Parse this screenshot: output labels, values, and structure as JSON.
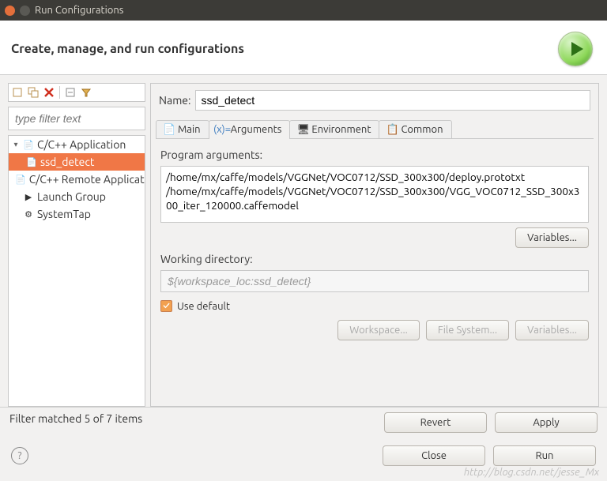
{
  "window": {
    "title": "Run Configurations"
  },
  "header": {
    "heading": "Create, manage, and run configurations"
  },
  "sidebar": {
    "filter_placeholder": "type filter text",
    "items": [
      {
        "label": "C/C++ Application",
        "expanded": true
      },
      {
        "label": "ssd_detect",
        "selected": true,
        "child": true
      },
      {
        "label": "C/C++ Remote Application"
      },
      {
        "label": "Launch Group"
      },
      {
        "label": "SystemTap"
      }
    ],
    "status": "Filter matched 5 of 7 items"
  },
  "form": {
    "name_label": "Name:",
    "name_value": "ssd_detect",
    "tabs": [
      {
        "label": "Main"
      },
      {
        "label": "Arguments",
        "active": true
      },
      {
        "label": "Environment"
      },
      {
        "label": "Common"
      }
    ],
    "program_args_label": "Program arguments:",
    "program_args_value": "/home/mx/caffe/models/VGGNet/VOC0712/SSD_300x300/deploy.prototxt\n/home/mx/caffe/models/VGGNet/VOC0712/SSD_300x300/VGG_VOC0712_SSD_300x300_iter_120000.caffemodel",
    "variables_btn": "Variables...",
    "working_dir_label": "Working directory:",
    "working_dir_value": "${workspace_loc:ssd_detect}",
    "use_default_label": "Use default",
    "use_default_checked": true,
    "workspace_btn": "Workspace...",
    "filesystem_btn": "File System...",
    "variables2_btn": "Variables...",
    "revert_btn": "Revert",
    "apply_btn": "Apply"
  },
  "footer": {
    "close_btn": "Close",
    "run_btn": "Run"
  },
  "watermark": "http://blog.csdn.net/jesse_Mx"
}
